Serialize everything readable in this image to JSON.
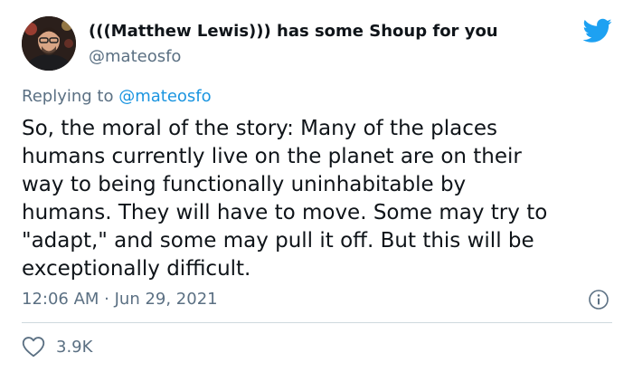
{
  "author": {
    "display_name": "(((Matthew Lewis))) has some Shoup for you",
    "handle": "@mateosfo"
  },
  "reply": {
    "prefix": "Replying to",
    "handle": "@mateosfo"
  },
  "tweet": {
    "lines": [
      "So, the moral of the story: Many of the places",
      "humans currently live on the planet are on their",
      "way to being functionally uninhabitable by",
      "humans. They will have to move. Some may try to",
      "\"adapt,\" and some may pull it off. But this will be",
      "exceptionally difficult."
    ],
    "timestamp": "12:06 AM · Jun 29, 2021"
  },
  "engagement": {
    "likes": "3.9K"
  },
  "icons": {
    "brand": "twitter-bird-icon",
    "info": "info-icon",
    "like": "heart-icon"
  },
  "colors": {
    "brand_blue": "#1da1f2",
    "link_blue": "#1b95e0",
    "secondary_text": "#5b7083",
    "primary_text": "#0f1419",
    "divider": "#cfd9de"
  }
}
